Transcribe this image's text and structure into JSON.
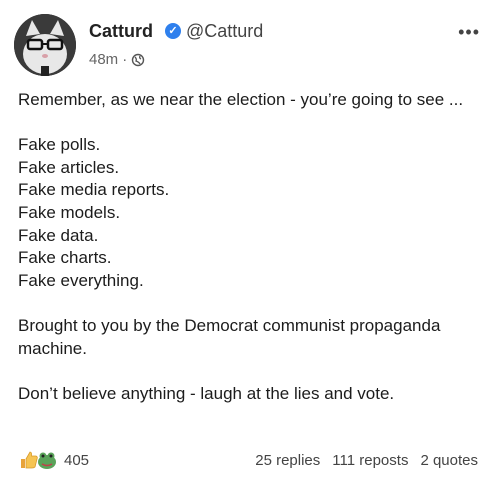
{
  "author": {
    "display_name": "Catturd",
    "handle": "@Catturd",
    "timestamp": "48m",
    "verified": true
  },
  "icons": {
    "verified": "verified-badge-icon",
    "visibility": "globe-icon",
    "more": "more-options-icon"
  },
  "post": {
    "lines": [
      "Remember, as we near the election - you’re going to see ...",
      "",
      "Fake polls.",
      "Fake articles.",
      "Fake media reports.",
      "Fake models.",
      "Fake data.",
      "Fake charts.",
      "Fake everything.",
      "",
      "Brought to you by the Democrat communist propaganda machine.",
      "",
      "Don’t believe anything - laugh at the lies and vote."
    ]
  },
  "engagement": {
    "reaction_count": "405",
    "replies": "25 replies",
    "reposts": "111 reposts",
    "quotes": "2 quotes"
  },
  "colors": {
    "verified_blue": "#2f80ed",
    "text": "#1c1c1c",
    "muted": "#666666"
  }
}
